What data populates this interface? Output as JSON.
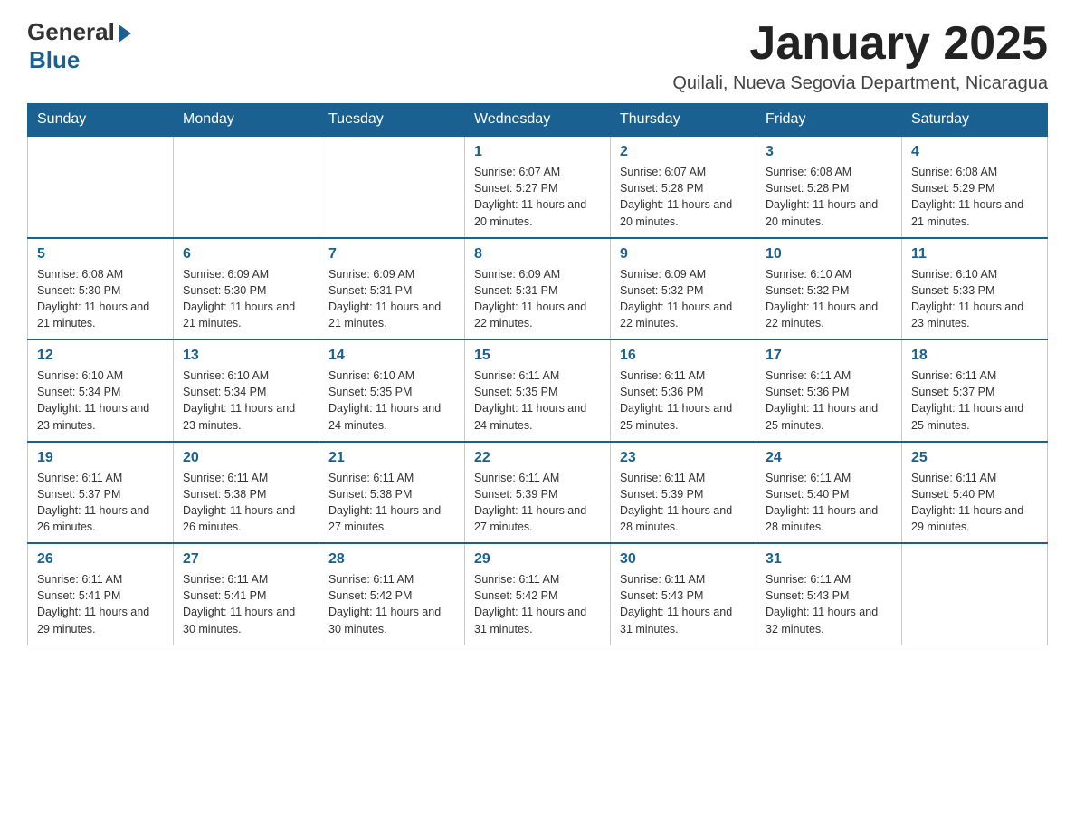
{
  "logo": {
    "general": "General",
    "blue": "Blue"
  },
  "title": "January 2025",
  "subtitle": "Quilali, Nueva Segovia Department, Nicaragua",
  "days_of_week": [
    "Sunday",
    "Monday",
    "Tuesday",
    "Wednesday",
    "Thursday",
    "Friday",
    "Saturday"
  ],
  "weeks": [
    [
      {
        "day": "",
        "sunrise": "",
        "sunset": "",
        "daylight": ""
      },
      {
        "day": "",
        "sunrise": "",
        "sunset": "",
        "daylight": ""
      },
      {
        "day": "",
        "sunrise": "",
        "sunset": "",
        "daylight": ""
      },
      {
        "day": "1",
        "sunrise": "Sunrise: 6:07 AM",
        "sunset": "Sunset: 5:27 PM",
        "daylight": "Daylight: 11 hours and 20 minutes."
      },
      {
        "day": "2",
        "sunrise": "Sunrise: 6:07 AM",
        "sunset": "Sunset: 5:28 PM",
        "daylight": "Daylight: 11 hours and 20 minutes."
      },
      {
        "day": "3",
        "sunrise": "Sunrise: 6:08 AM",
        "sunset": "Sunset: 5:28 PM",
        "daylight": "Daylight: 11 hours and 20 minutes."
      },
      {
        "day": "4",
        "sunrise": "Sunrise: 6:08 AM",
        "sunset": "Sunset: 5:29 PM",
        "daylight": "Daylight: 11 hours and 21 minutes."
      }
    ],
    [
      {
        "day": "5",
        "sunrise": "Sunrise: 6:08 AM",
        "sunset": "Sunset: 5:30 PM",
        "daylight": "Daylight: 11 hours and 21 minutes."
      },
      {
        "day": "6",
        "sunrise": "Sunrise: 6:09 AM",
        "sunset": "Sunset: 5:30 PM",
        "daylight": "Daylight: 11 hours and 21 minutes."
      },
      {
        "day": "7",
        "sunrise": "Sunrise: 6:09 AM",
        "sunset": "Sunset: 5:31 PM",
        "daylight": "Daylight: 11 hours and 21 minutes."
      },
      {
        "day": "8",
        "sunrise": "Sunrise: 6:09 AM",
        "sunset": "Sunset: 5:31 PM",
        "daylight": "Daylight: 11 hours and 22 minutes."
      },
      {
        "day": "9",
        "sunrise": "Sunrise: 6:09 AM",
        "sunset": "Sunset: 5:32 PM",
        "daylight": "Daylight: 11 hours and 22 minutes."
      },
      {
        "day": "10",
        "sunrise": "Sunrise: 6:10 AM",
        "sunset": "Sunset: 5:32 PM",
        "daylight": "Daylight: 11 hours and 22 minutes."
      },
      {
        "day": "11",
        "sunrise": "Sunrise: 6:10 AM",
        "sunset": "Sunset: 5:33 PM",
        "daylight": "Daylight: 11 hours and 23 minutes."
      }
    ],
    [
      {
        "day": "12",
        "sunrise": "Sunrise: 6:10 AM",
        "sunset": "Sunset: 5:34 PM",
        "daylight": "Daylight: 11 hours and 23 minutes."
      },
      {
        "day": "13",
        "sunrise": "Sunrise: 6:10 AM",
        "sunset": "Sunset: 5:34 PM",
        "daylight": "Daylight: 11 hours and 23 minutes."
      },
      {
        "day": "14",
        "sunrise": "Sunrise: 6:10 AM",
        "sunset": "Sunset: 5:35 PM",
        "daylight": "Daylight: 11 hours and 24 minutes."
      },
      {
        "day": "15",
        "sunrise": "Sunrise: 6:11 AM",
        "sunset": "Sunset: 5:35 PM",
        "daylight": "Daylight: 11 hours and 24 minutes."
      },
      {
        "day": "16",
        "sunrise": "Sunrise: 6:11 AM",
        "sunset": "Sunset: 5:36 PM",
        "daylight": "Daylight: 11 hours and 25 minutes."
      },
      {
        "day": "17",
        "sunrise": "Sunrise: 6:11 AM",
        "sunset": "Sunset: 5:36 PM",
        "daylight": "Daylight: 11 hours and 25 minutes."
      },
      {
        "day": "18",
        "sunrise": "Sunrise: 6:11 AM",
        "sunset": "Sunset: 5:37 PM",
        "daylight": "Daylight: 11 hours and 25 minutes."
      }
    ],
    [
      {
        "day": "19",
        "sunrise": "Sunrise: 6:11 AM",
        "sunset": "Sunset: 5:37 PM",
        "daylight": "Daylight: 11 hours and 26 minutes."
      },
      {
        "day": "20",
        "sunrise": "Sunrise: 6:11 AM",
        "sunset": "Sunset: 5:38 PM",
        "daylight": "Daylight: 11 hours and 26 minutes."
      },
      {
        "day": "21",
        "sunrise": "Sunrise: 6:11 AM",
        "sunset": "Sunset: 5:38 PM",
        "daylight": "Daylight: 11 hours and 27 minutes."
      },
      {
        "day": "22",
        "sunrise": "Sunrise: 6:11 AM",
        "sunset": "Sunset: 5:39 PM",
        "daylight": "Daylight: 11 hours and 27 minutes."
      },
      {
        "day": "23",
        "sunrise": "Sunrise: 6:11 AM",
        "sunset": "Sunset: 5:39 PM",
        "daylight": "Daylight: 11 hours and 28 minutes."
      },
      {
        "day": "24",
        "sunrise": "Sunrise: 6:11 AM",
        "sunset": "Sunset: 5:40 PM",
        "daylight": "Daylight: 11 hours and 28 minutes."
      },
      {
        "day": "25",
        "sunrise": "Sunrise: 6:11 AM",
        "sunset": "Sunset: 5:40 PM",
        "daylight": "Daylight: 11 hours and 29 minutes."
      }
    ],
    [
      {
        "day": "26",
        "sunrise": "Sunrise: 6:11 AM",
        "sunset": "Sunset: 5:41 PM",
        "daylight": "Daylight: 11 hours and 29 minutes."
      },
      {
        "day": "27",
        "sunrise": "Sunrise: 6:11 AM",
        "sunset": "Sunset: 5:41 PM",
        "daylight": "Daylight: 11 hours and 30 minutes."
      },
      {
        "day": "28",
        "sunrise": "Sunrise: 6:11 AM",
        "sunset": "Sunset: 5:42 PM",
        "daylight": "Daylight: 11 hours and 30 minutes."
      },
      {
        "day": "29",
        "sunrise": "Sunrise: 6:11 AM",
        "sunset": "Sunset: 5:42 PM",
        "daylight": "Daylight: 11 hours and 31 minutes."
      },
      {
        "day": "30",
        "sunrise": "Sunrise: 6:11 AM",
        "sunset": "Sunset: 5:43 PM",
        "daylight": "Daylight: 11 hours and 31 minutes."
      },
      {
        "day": "31",
        "sunrise": "Sunrise: 6:11 AM",
        "sunset": "Sunset: 5:43 PM",
        "daylight": "Daylight: 11 hours and 32 minutes."
      },
      {
        "day": "",
        "sunrise": "",
        "sunset": "",
        "daylight": ""
      }
    ]
  ]
}
